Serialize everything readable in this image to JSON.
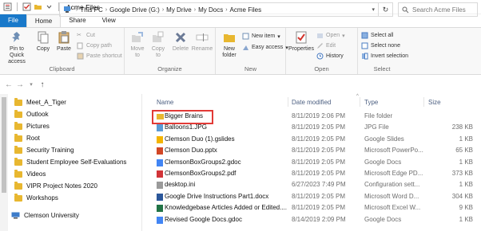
{
  "window": {
    "title": "Acme Files",
    "quick_access_icons": [
      "properties-icon",
      "checkbox-icon",
      "folder-icon",
      "qa-dropdown-icon"
    ]
  },
  "tabs": [
    "File",
    "Home",
    "Share",
    "View"
  ],
  "ribbon": {
    "clipboard": {
      "label": "Clipboard",
      "pin": "Pin to Quick access",
      "copy": "Copy",
      "paste": "Paste",
      "cut": "Cut",
      "copy_path": "Copy path",
      "paste_shortcut": "Paste shortcut"
    },
    "organize": {
      "label": "Organize",
      "move_to": "Move to",
      "copy_to": "Copy to",
      "delete": "Delete",
      "rename": "Rename"
    },
    "new": {
      "label": "New",
      "new_folder": "New folder",
      "new_item": "New item",
      "easy_access": "Easy access"
    },
    "open": {
      "label": "Open",
      "properties": "Properties",
      "open": "Open",
      "edit": "Edit",
      "history": "History"
    },
    "select": {
      "label": "Select",
      "select_all": "Select all",
      "select_none": "Select none",
      "invert": "Invert selection"
    }
  },
  "address": {
    "crumbs": [
      "This PC",
      "Google Drive (G:)",
      "My Drive",
      "My Docs",
      "Acme Files"
    ],
    "search_placeholder": "Search Acme Files"
  },
  "nav": {
    "items": [
      "Meet_A_Tiger",
      "Outlook",
      "Pictures",
      "Root",
      "Security Training",
      "Student Employee Self-Evaluations",
      "Videos",
      "VIPR Project Notes 2020",
      "Workshops"
    ],
    "network": "Clemson University"
  },
  "columns": {
    "name": "Name",
    "date": "Date modified",
    "type": "Type",
    "size": "Size"
  },
  "files": [
    {
      "name": "Bigger Brains",
      "date": "8/11/2019 2:06 PM",
      "type": "File folder",
      "size": "",
      "icon": "folder"
    },
    {
      "name": "Balloons1.JPG",
      "date": "8/11/2019 2:05 PM",
      "type": "JPG File",
      "size": "238 KB",
      "icon": "image"
    },
    {
      "name": "Clemson Duo (1).gslides",
      "date": "8/11/2019 2:05 PM",
      "type": "Google Slides",
      "size": "1 KB",
      "icon": "gslides"
    },
    {
      "name": "Clemson Duo.pptx",
      "date": "8/11/2019 2:05 PM",
      "type": "Microsoft PowerPo...",
      "size": "65 KB",
      "icon": "pptx"
    },
    {
      "name": "ClemsonBoxGroups2.gdoc",
      "date": "8/11/2019 2:05 PM",
      "type": "Google Docs",
      "size": "1 KB",
      "icon": "gdoc"
    },
    {
      "name": "ClemsonBoxGroups2.pdf",
      "date": "8/11/2019 2:05 PM",
      "type": "Microsoft Edge PD...",
      "size": "373 KB",
      "icon": "pdf"
    },
    {
      "name": "desktop.ini",
      "date": "6/27/2023 7:49 PM",
      "type": "Configuration sett...",
      "size": "1 KB",
      "icon": "ini"
    },
    {
      "name": "Google Drive Instructions Part1.docx",
      "date": "8/11/2019 2:05 PM",
      "type": "Microsoft Word D...",
      "size": "304 KB",
      "icon": "docx"
    },
    {
      "name": "Knowledgebase Articles Added or Edited....",
      "date": "8/11/2019 2:05 PM",
      "type": "Microsoft Excel W...",
      "size": "9 KB",
      "icon": "xlsx"
    },
    {
      "name": "Revised Google Docs.gdoc",
      "date": "8/14/2019 2:09 PM",
      "type": "Google Docs",
      "size": "1 KB",
      "icon": "gdoc"
    }
  ],
  "colors": {
    "file_tab": "#1979ca",
    "highlight_box": "#e23a36",
    "folder": "#e8b730",
    "header_text": "#4d6082"
  }
}
